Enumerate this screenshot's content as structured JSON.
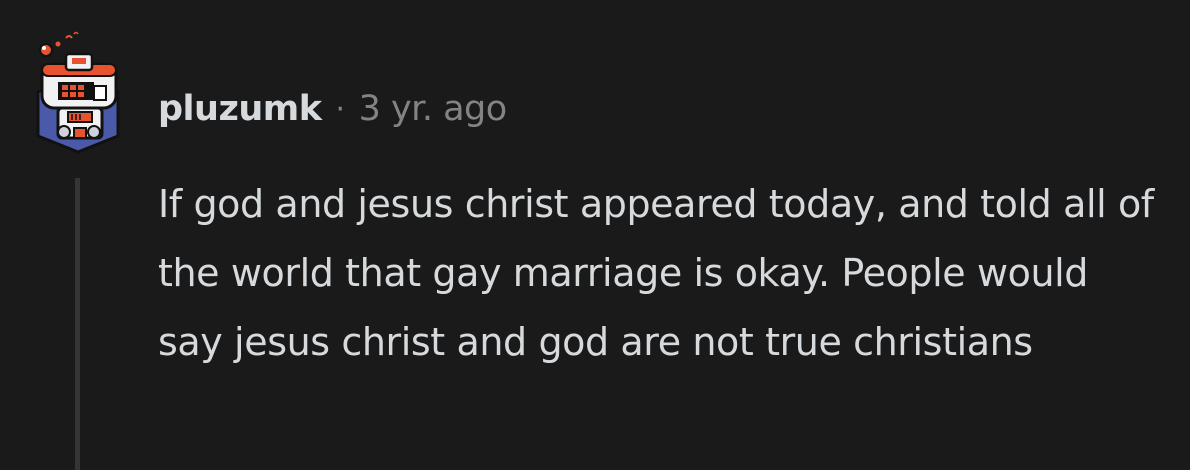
{
  "comment": {
    "username": "pluzumk",
    "separator": "·",
    "timestamp": "3 yr. ago",
    "body": "If god and jesus christ appeared today, and told all of the world that gay marriage is okay. People would say jesus christ and god are not true christians"
  },
  "avatar": {
    "icon": "robot-avatar-icon",
    "colors": {
      "background": "#4a5aa8",
      "helmet": "#f2f2f2",
      "accent": "#e8532f",
      "outline": "#111111"
    }
  },
  "theme": {
    "background": "#1a1a1b",
    "text": "#d7dadc",
    "meta": "#818384",
    "thread_line": "#343536"
  }
}
